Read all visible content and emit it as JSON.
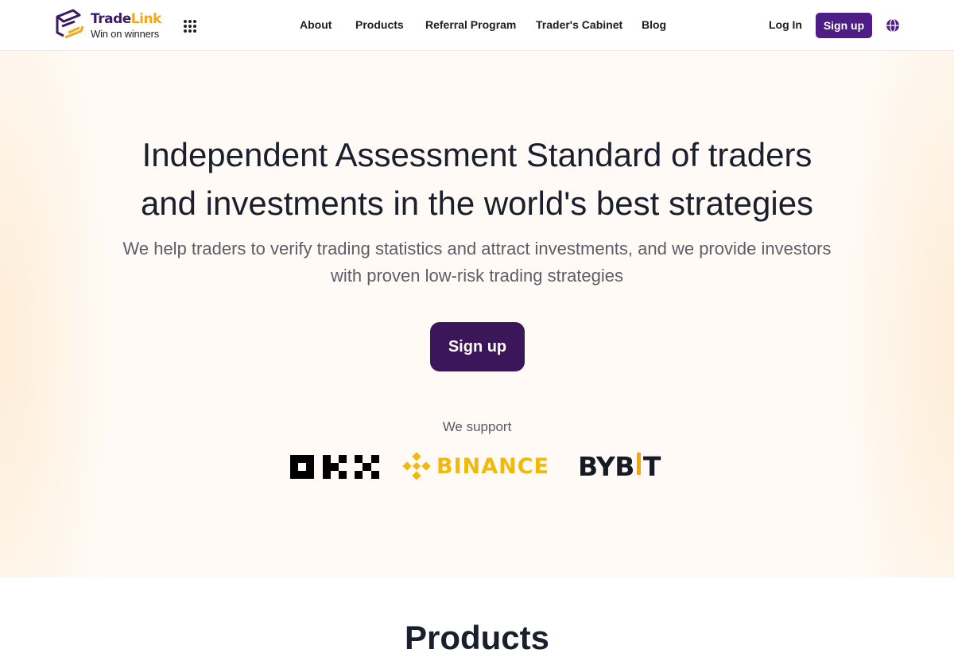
{
  "brand": {
    "name_part1": "Trade",
    "name_part2": "Link",
    "tagline": "Win on winners",
    "primary_color": "#4e1d85",
    "accent_color": "#f2a81d"
  },
  "nav": {
    "items": [
      "About",
      "Products",
      "Referral Program",
      "Trader's Cabinet",
      "Blog"
    ]
  },
  "auth": {
    "login_label": "Log In",
    "signup_label": "Sign up"
  },
  "hero": {
    "title_line1": "Independent Assessment Standard of traders",
    "title_line2": "and investments in the world's best strategies",
    "subtitle_line1": "We help traders to verify trading statistics and attract investments, and we provide investors",
    "subtitle_line2": "with proven low-risk trading strategies",
    "cta_label": "Sign up",
    "support_label": "We support"
  },
  "partners": {
    "okx": "OKX",
    "binance": "BINANCE",
    "bybit_part1": "BYB",
    "bybit_part2": "T"
  },
  "products": {
    "title": "Products"
  }
}
